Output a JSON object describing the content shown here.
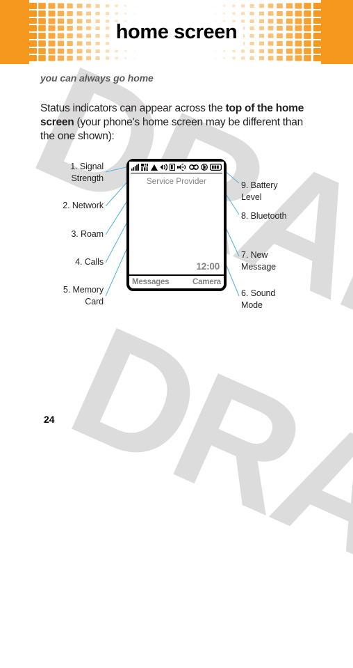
{
  "header": {
    "title": "home screen",
    "accent_color": "#F6981E"
  },
  "body": {
    "subtitle": "you can always go home",
    "paragraph_part1": "Status indicators can appear across the ",
    "paragraph_bold1": "top of the home screen",
    "paragraph_part2": " (your phone’s home screen may be different than the one shown):"
  },
  "watermark": {
    "text": "DRAFT"
  },
  "callouts": {
    "left": [
      {
        "num": "1.",
        "label": "Signal\nStrength",
        "icon": "signal-strength-icon"
      },
      {
        "num": "2.",
        "label": "Network",
        "icon": "network-icon"
      },
      {
        "num": "3.",
        "label": "Roam",
        "icon": "roam-icon"
      },
      {
        "num": "4.",
        "label": "Calls",
        "icon": "calls-icon"
      },
      {
        "num": "5.",
        "label": "Memory\nCard",
        "icon": "memory-card-icon"
      }
    ],
    "right": [
      {
        "num": "9.",
        "label": "Battery\nLevel",
        "icon": "battery-level-icon"
      },
      {
        "num": "8.",
        "label": "Bluetooth",
        "icon": "bluetooth-icon"
      },
      {
        "num": "7.",
        "label": "New\nMessage",
        "icon": "new-message-icon"
      },
      {
        "num": "6.",
        "label": "Sound\nMode",
        "icon": "sound-mode-icon"
      }
    ],
    "line_color": "#5BB3E4"
  },
  "phone": {
    "status_icons": [
      "signal-strength-icon",
      "network-icon",
      "roam-icon",
      "calls-icon",
      "memory-card-icon",
      "sound-mode-icon",
      "new-message-icon",
      "bluetooth-icon",
      "battery-level-icon"
    ],
    "service_provider": "Service Provider",
    "clock": "12:00",
    "softkey_left": "Messages",
    "softkey_right": "Camera"
  },
  "footer": {
    "page_number": "24"
  }
}
